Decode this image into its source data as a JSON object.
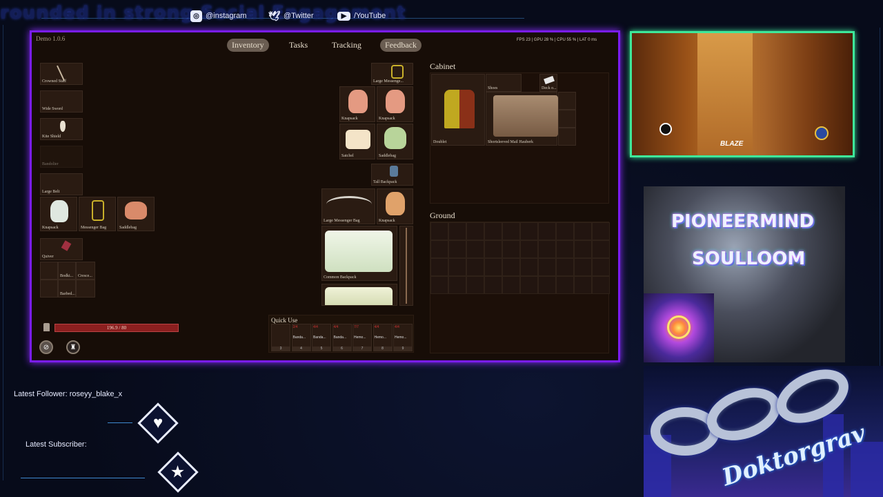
{
  "overlay": {
    "ticker_text": "rounded in strong Social Engagement",
    "socials": [
      {
        "icon": "instagram-icon",
        "label": "@instagram"
      },
      {
        "icon": "twitter-icon",
        "label": "@Twitter"
      },
      {
        "icon": "youtube-icon",
        "label": "/YouTube"
      }
    ],
    "latest_follower_label": "Latest Follower:",
    "latest_follower_name": "roseyy_blake_x",
    "latest_subscriber_label": "Latest Subscriber:",
    "graffiti_line1": "PIONEERMIND",
    "graffiti_line2": "SOULLOOM",
    "signature": "Doktorgrav",
    "colors": {
      "frame": "#7a1cf0",
      "cam_frame": "#3ee89a",
      "hp_bar": "#8b1f1f"
    }
  },
  "webcam": {
    "blaze_label": "BLAZE"
  },
  "game": {
    "version": "Demo 1.0.6",
    "tabs": [
      "Inventory",
      "Tasks",
      "Tracking",
      "Feedback"
    ],
    "active_tab": "Inventory",
    "stats": "FPS 23 | GPU 28 % | CPU 55 % | LAT 0 ms",
    "equipment": {
      "left_column": [
        "Crowned Staff",
        "Wide Sword",
        "Kite Shield",
        "Bandolier",
        "Large Belt"
      ],
      "belt_items": [
        "Knapsack",
        "Messenger Bag",
        "Saddlebag"
      ],
      "quiver": "Quiver",
      "quiver_items": [
        "Bodki...",
        "Cresce...",
        "Barbed..."
      ]
    },
    "containers": {
      "top": [
        "Large Messenge...",
        "Knapsack",
        "Knapsack",
        "Satchel",
        "Saddlebag",
        "Tall Backpack"
      ],
      "bottom": [
        "Large Messenger Bag",
        "Knapsack",
        "Common Backpack"
      ]
    },
    "health": {
      "text": "196.9 / 80"
    },
    "quick_use": {
      "title": "Quick Use",
      "slots": [
        {
          "label": "",
          "count": "",
          "key": "3"
        },
        {
          "label": "Banda...",
          "count": "2/4",
          "key": "4"
        },
        {
          "label": "Banda...",
          "count": "4/4",
          "key": "5"
        },
        {
          "label": "Banda...",
          "count": "4/4",
          "key": "6"
        },
        {
          "label": "Hemo...",
          "count": "7/7",
          "key": "7"
        },
        {
          "label": "Hemo...",
          "count": "4/4",
          "key": "8"
        },
        {
          "label": "Hemo...",
          "count": "4/4",
          "key": "9"
        }
      ]
    },
    "cabinet": {
      "title": "Cabinet",
      "items": [
        "Doublet",
        "Shoes",
        "Deck o...",
        "Shortsleeved Mail Hauberk"
      ]
    },
    "ground": {
      "title": "Ground"
    }
  }
}
